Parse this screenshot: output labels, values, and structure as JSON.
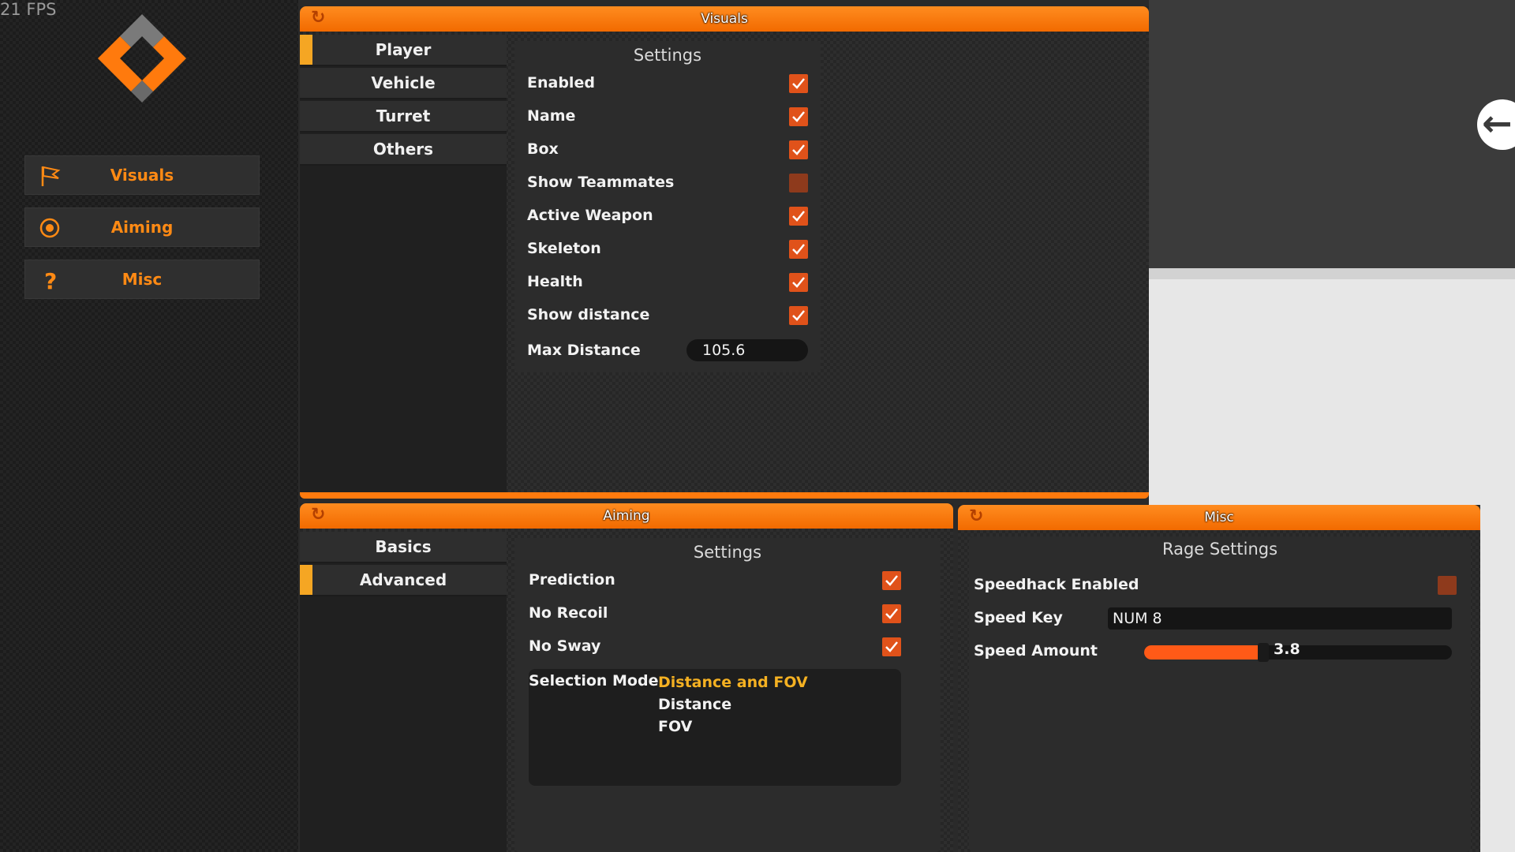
{
  "fps": "21 FPS",
  "colors": {
    "accent": "#ff7a0d",
    "tab_indicator": "#f5a623",
    "checkbox": "#e0521a",
    "selected_option": "#f5b122"
  },
  "sidebar": {
    "items": [
      {
        "label": "Visuals",
        "icon": "flag-icon"
      },
      {
        "label": "Aiming",
        "icon": "crosshair-icon"
      },
      {
        "label": "Misc",
        "icon": "question-icon"
      }
    ]
  },
  "visuals": {
    "title": "Visuals",
    "tabs": [
      {
        "label": "Player",
        "active": true
      },
      {
        "label": "Vehicle",
        "active": false
      },
      {
        "label": "Turret",
        "active": false
      },
      {
        "label": "Others",
        "active": false
      }
    ],
    "heading": "Settings",
    "options": [
      {
        "label": "Enabled",
        "checked": true
      },
      {
        "label": "Name",
        "checked": true
      },
      {
        "label": "Box",
        "checked": true
      },
      {
        "label": "Show Teammates",
        "checked": false
      },
      {
        "label": "Active Weapon",
        "checked": true
      },
      {
        "label": "Skeleton",
        "checked": true
      },
      {
        "label": "Health",
        "checked": true
      },
      {
        "label": "Show distance",
        "checked": true
      }
    ],
    "max_distance": {
      "label": "Max Distance",
      "value": "105.6"
    }
  },
  "aiming": {
    "title": "Aiming",
    "tabs": [
      {
        "label": "Basics",
        "active": false
      },
      {
        "label": "Advanced",
        "active": true
      }
    ],
    "heading": "Settings",
    "options": [
      {
        "label": "Prediction",
        "checked": true
      },
      {
        "label": "No Recoil",
        "checked": true
      },
      {
        "label": "No Sway",
        "checked": true
      }
    ],
    "selection_mode": {
      "label": "Selection Mode",
      "options": [
        "Distance and FOV",
        "Distance",
        "FOV"
      ],
      "selected": "Distance and FOV"
    }
  },
  "misc": {
    "title": "Misc",
    "heading": "Rage Settings",
    "speedhack": {
      "label": "Speedhack Enabled",
      "checked": false
    },
    "speed_key": {
      "label": "Speed Key",
      "value": "NUM 8"
    },
    "speed_amount": {
      "label": "Speed Amount",
      "value": "3.8",
      "fill_fraction": 0.38
    }
  }
}
